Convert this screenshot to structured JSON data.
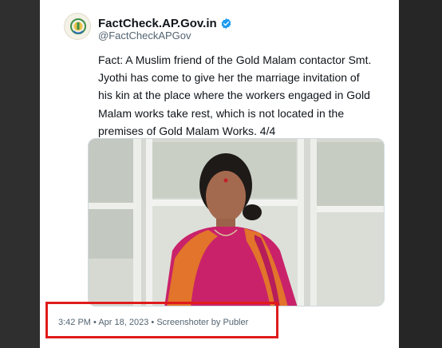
{
  "tweet": {
    "display_name": "FactCheck.AP.Gov.in",
    "handle": "@FactCheckAPGov",
    "text": "Fact: A Muslim friend of the Gold Malam contactor Smt. Jyothi has come to give her the marriage invitation of his kin at the place where the workers engaged in Gold Malam works take rest, which is not located in the premises of Gold Malam Works. 4/4",
    "time": "3:42 PM",
    "date": "Apr 18, 2023",
    "source": "Screenshoter by Publer",
    "separator": "•"
  },
  "icons": {
    "verified": "verified-badge-icon",
    "avatar": "ap-government-emblem"
  },
  "colors": {
    "verified_blue": "#1d9bf0",
    "highlight_red": "#e01b1b"
  }
}
